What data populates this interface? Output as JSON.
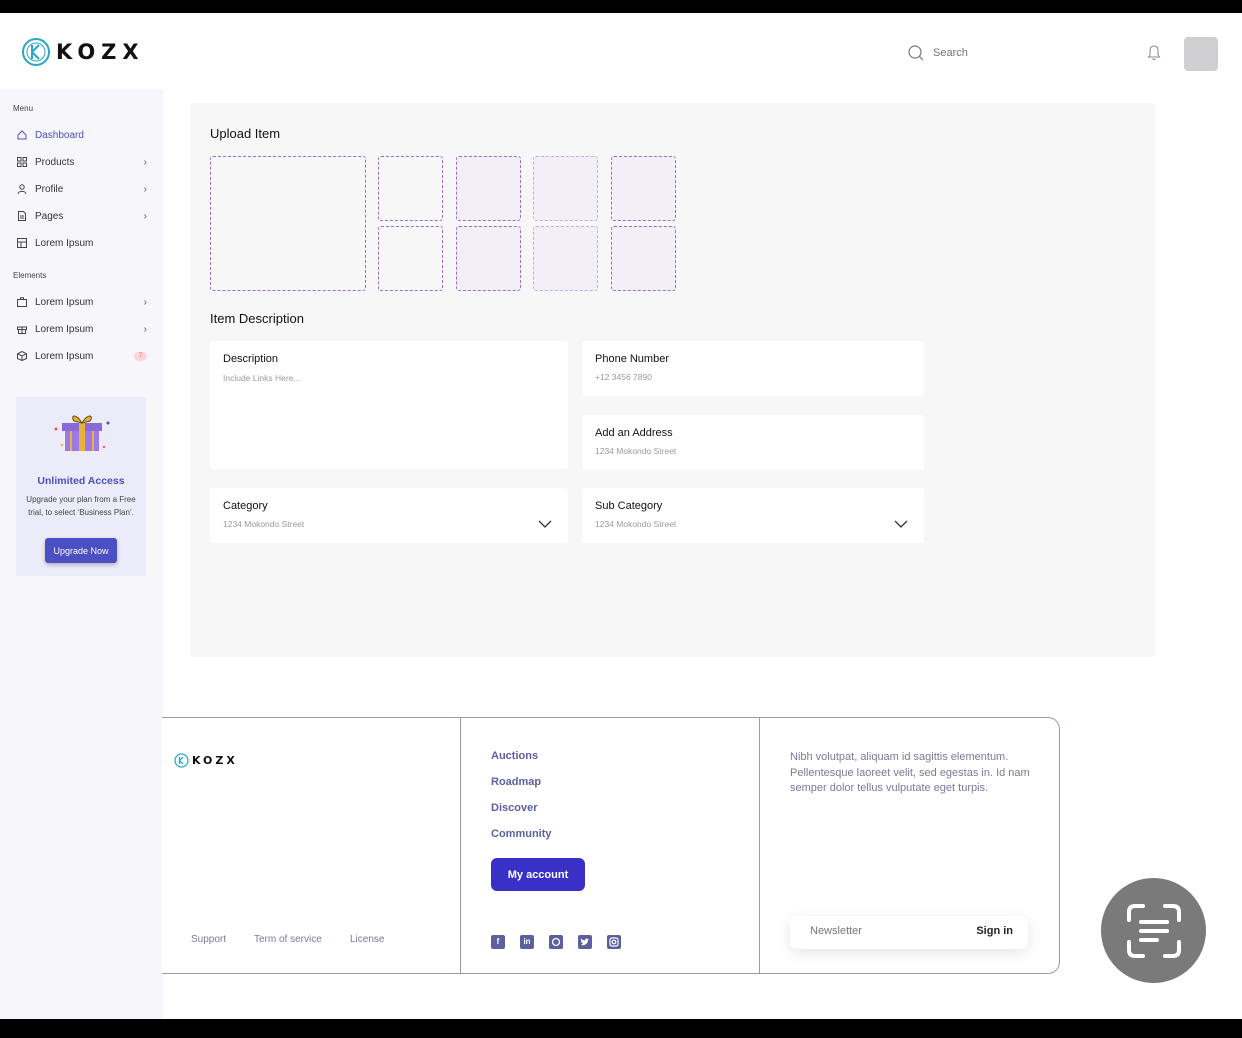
{
  "header": {
    "brand": "KOZX",
    "search_placeholder": "Search"
  },
  "sidebar": {
    "menu_label": "Menu",
    "elements_label": "Elements",
    "menu_items": [
      {
        "label": "Dashboard",
        "icon": "home-icon"
      },
      {
        "label": "Products",
        "icon": "grid-icon"
      },
      {
        "label": "Profile",
        "icon": "user-icon"
      },
      {
        "label": "Pages",
        "icon": "document-icon"
      },
      {
        "label": "Lorem Ipsum",
        "icon": "layout-icon"
      }
    ],
    "element_items": [
      {
        "label": "Lorem Ipsum",
        "icon": "briefcase-icon"
      },
      {
        "label": "Lorem Ipsum",
        "icon": "gift-icon"
      },
      {
        "label": "Lorem Ipsum",
        "icon": "box-icon",
        "badge": "7"
      }
    ],
    "promo": {
      "title": "Unlimited Access",
      "text": "Upgrade your plan from a Free trial, to select ‘Business Plan’.",
      "button": "Upgrade Now"
    }
  },
  "main": {
    "upload_title": "Upload Item",
    "description_title": "Item Description",
    "fields": {
      "description": {
        "label": "Description",
        "placeholder": "Include Links Here..."
      },
      "phone": {
        "label": "Phone Number",
        "placeholder": "+12 3456 7890"
      },
      "address": {
        "label": "Add an Address",
        "placeholder": "1234 Mokondo Street"
      },
      "category": {
        "label": "Category",
        "value": "1234 Mokondo Street"
      },
      "subcategory": {
        "label": "Sub Category",
        "value": "1234 Mokondo Street"
      }
    }
  },
  "footer": {
    "brand": "KOZX",
    "links": [
      "Support",
      "Term of service",
      "License"
    ],
    "nav": [
      "Auctions",
      "Roadmap",
      "Discover",
      "Community"
    ],
    "account_button": "My account",
    "social": [
      "facebook-icon",
      "linkedin-icon",
      "github-icon",
      "twitter-icon",
      "instagram-icon"
    ],
    "about": "Nibh volutpat, aliquam id sagittis elementum. Pellentesque laoreet velit, sed egestas in. Id nam semper dolor tellus vulputate eget turpis.",
    "newsletter_placeholder": "Newsletter",
    "signin": "Sign in"
  },
  "colors": {
    "accent": "#4b4fc4",
    "button_primary": "#3930c8",
    "dashed_border": "#9a6ad6"
  }
}
